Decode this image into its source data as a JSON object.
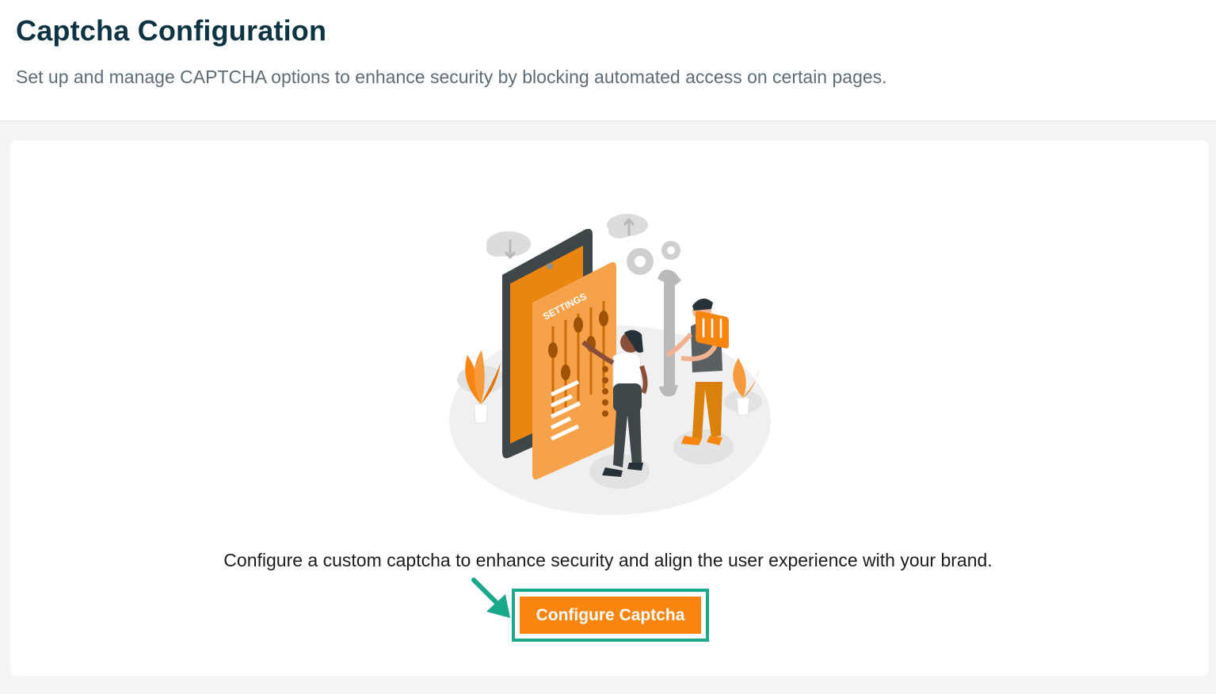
{
  "header": {
    "title": "Captcha Configuration",
    "subtitle": "Set up and manage CAPTCHA options to enhance security by blocking automated access on certain pages."
  },
  "main": {
    "illustration": {
      "icon": "settings-illustration",
      "label": "SETTINGS"
    },
    "description": "Configure a custom captcha to enhance security and align the user experience with your brand.",
    "configure_button_label": "Configure Captcha",
    "highlight_arrow_icon": "arrow-icon"
  },
  "colors": {
    "accent": "#f7850f",
    "highlight": "#1aa88a",
    "title": "#0e3444",
    "subtitle": "#5f6b76"
  }
}
